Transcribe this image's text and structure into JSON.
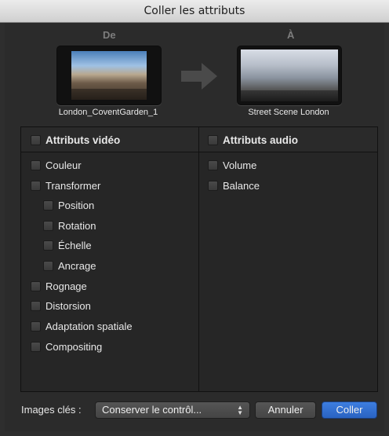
{
  "window": {
    "title": "Coller les attributs"
  },
  "source": {
    "label": "De",
    "clip_name": "London_CoventGarden_1"
  },
  "destination": {
    "label": "À",
    "clip_name": "Street Scene London"
  },
  "video": {
    "header": "Attributs vidéo",
    "items": [
      {
        "label": "Couleur"
      },
      {
        "label": "Transformer"
      },
      {
        "label": "Position"
      },
      {
        "label": "Rotation"
      },
      {
        "label": "Échelle"
      },
      {
        "label": "Ancrage"
      },
      {
        "label": "Rognage"
      },
      {
        "label": "Distorsion"
      },
      {
        "label": "Adaptation spatiale"
      },
      {
        "label": "Compositing"
      }
    ]
  },
  "audio": {
    "header": "Attributs audio",
    "items": [
      {
        "label": "Volume"
      },
      {
        "label": "Balance"
      }
    ]
  },
  "footer": {
    "keyframes_label": "Images clés :",
    "keyframes_value": "Conserver le contrôl...",
    "cancel_label": "Annuler",
    "paste_label": "Coller"
  }
}
